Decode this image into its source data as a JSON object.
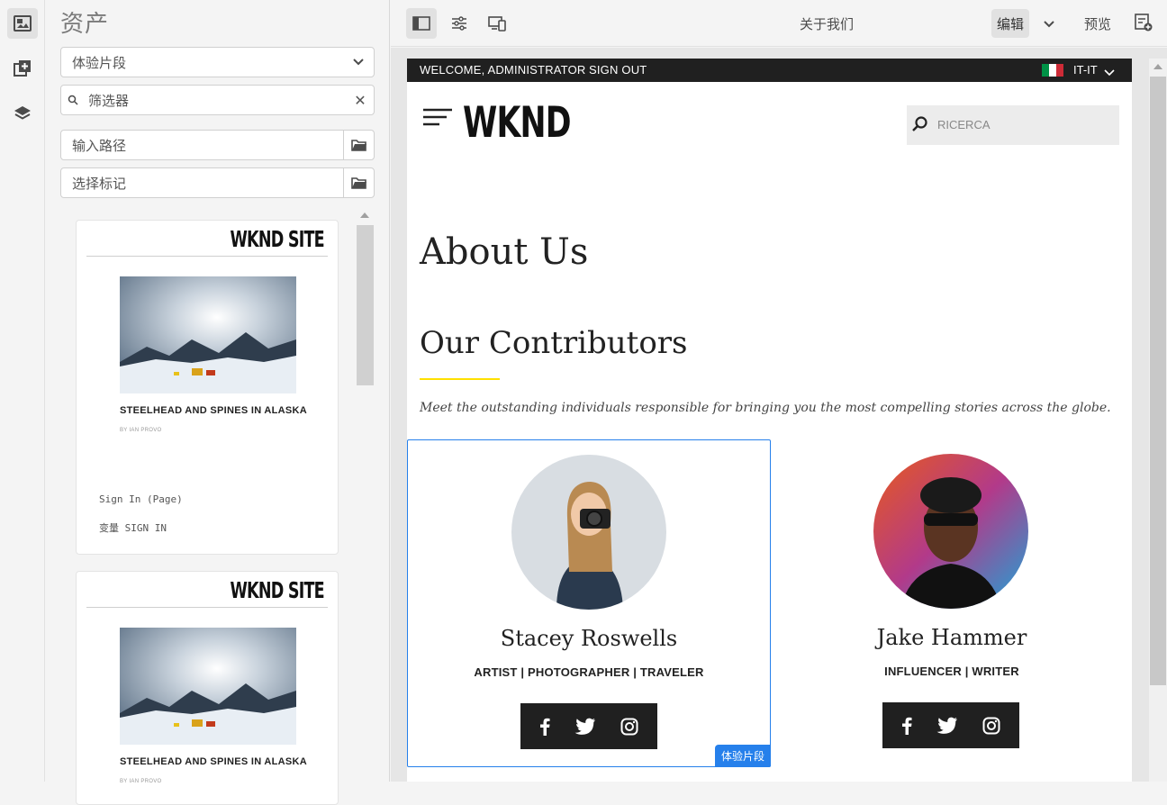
{
  "panel": {
    "title": "资产",
    "asset_type": "体验片段",
    "filter_placeholder": "筛选器",
    "path_placeholder": "输入路径",
    "tags_placeholder": "选择标记"
  },
  "cards": [
    {
      "brand": "WKND SITE",
      "headline": "STEELHEAD AND SPINES IN ALASKA",
      "byline": "BY IAN PROVO",
      "meta1": "Sign In (Page)",
      "meta2": "变量 SIGN IN"
    },
    {
      "brand": "WKND SITE",
      "headline": "STEELHEAD AND SPINES IN ALASKA",
      "byline": "BY IAN PROVO"
    }
  ],
  "toolbar": {
    "page_title": "关于我们",
    "edit_label": "编辑",
    "preview_label": "预览"
  },
  "site": {
    "welcome": "WELCOME, ADMINISTRATOR",
    "signout": "SIGN OUT",
    "language": "IT-IT",
    "flag_colors": [
      "#009246",
      "#ffffff",
      "#ce2b37"
    ],
    "logo": "WKND",
    "search_placeholder": "RICERCA",
    "heading": "About Us",
    "subheading": "Our Contributors",
    "intro": "Meet the outstanding individuals responsible for bringing you the most compelling stories across the globe.",
    "contributors": [
      {
        "name": "Stacey Roswells",
        "role": "ARTIST | PHOTOGRAPHER | TRAVELER"
      },
      {
        "name": "Jake Hammer",
        "role": "INFLUENCER | WRITER"
      }
    ],
    "fragment_badge": "体验片段"
  },
  "colors": {
    "accent": "#2680eb",
    "rule": "#ffe000",
    "dark": "#202020"
  }
}
